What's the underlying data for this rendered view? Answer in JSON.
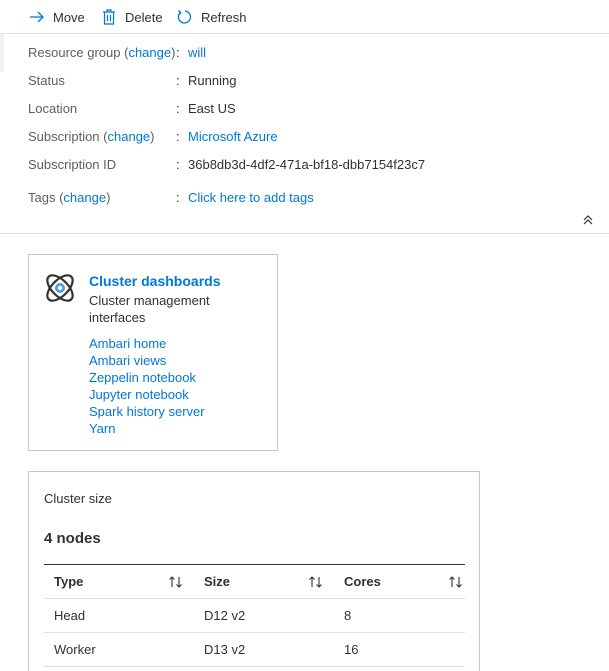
{
  "toolbar": {
    "move_label": "Move",
    "delete_label": "Delete",
    "refresh_label": "Refresh"
  },
  "essentials": {
    "resource_group": {
      "label": "Resource group",
      "change": "change",
      "value": "will"
    },
    "status": {
      "label": "Status",
      "value": "Running"
    },
    "location": {
      "label": "Location",
      "value": "East US"
    },
    "subscription": {
      "label": "Subscription",
      "change": "change",
      "value": "Microsoft Azure"
    },
    "subscription_id": {
      "label": "Subscription ID",
      "value": "36b8db3d-4df2-471a-bf18-dbb7154f23c7"
    },
    "tags": {
      "label": "Tags",
      "change": "change",
      "value": "Click here to add tags"
    }
  },
  "cluster_dashboards": {
    "title": "Cluster dashboards",
    "subtitle": "Cluster management interfaces",
    "links": [
      "Ambari home",
      "Ambari views",
      "Zeppelin notebook",
      "Jupyter notebook",
      "Spark history server",
      "Yarn"
    ]
  },
  "cluster_size": {
    "title": "Cluster size",
    "nodes": "4 nodes",
    "columns": [
      "Type",
      "Size",
      "Cores"
    ],
    "rows": [
      [
        "Head",
        "D12 v2",
        "8"
      ],
      [
        "Worker",
        "D13 v2",
        "16"
      ]
    ]
  },
  "colors": {
    "link": "#0078d4",
    "text": "#323130",
    "muted": "#605e5c",
    "border": "#c8c6c4"
  }
}
